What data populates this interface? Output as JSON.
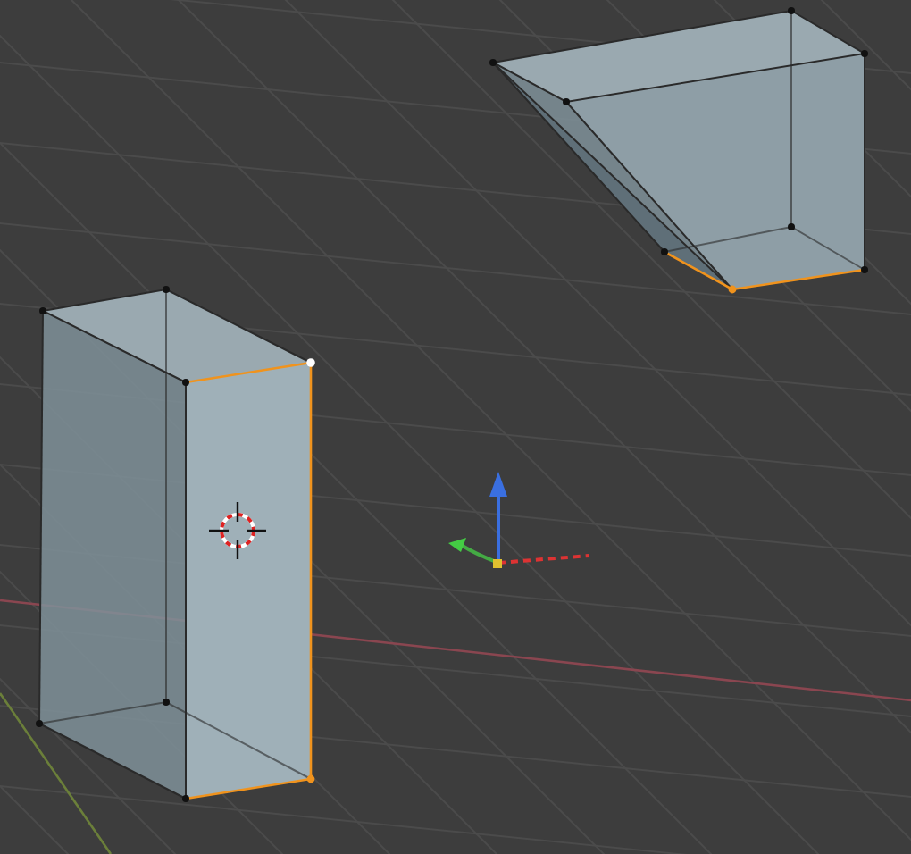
{
  "viewport": {
    "box": {
      "selected": true
    },
    "wedge": {
      "selected": true
    }
  }
}
